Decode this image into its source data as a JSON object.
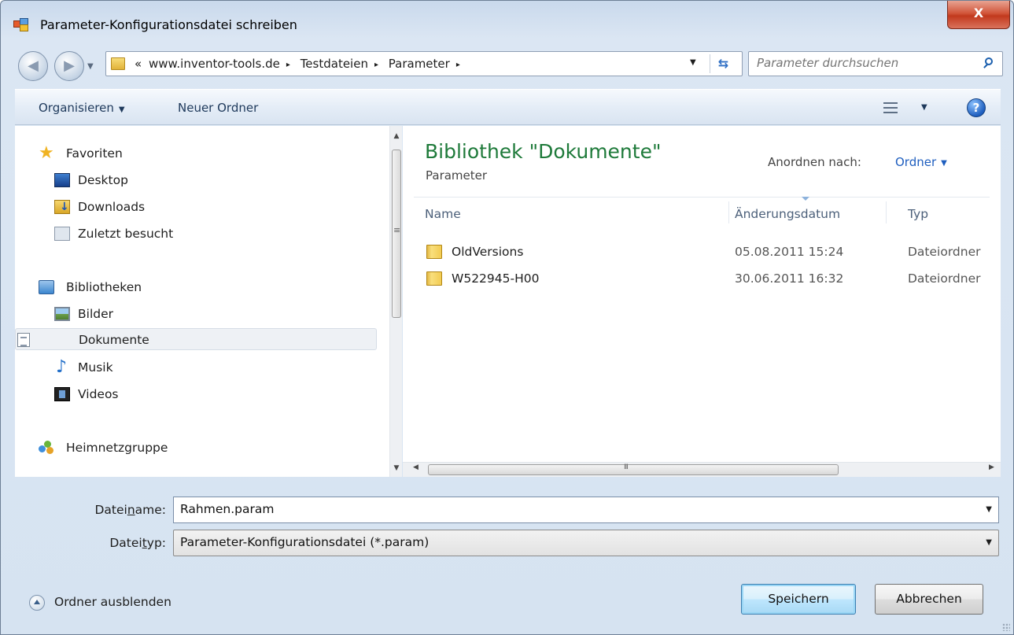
{
  "window": {
    "title": "Parameter-Konfigurationsdatei schreiben",
    "close_label": "X",
    "accent_color": "#1e7a3a",
    "link_color": "#1e5ebf"
  },
  "address_bar": {
    "chevron": "«",
    "crumbs": [
      "www.inventor-tools.de",
      "Testdateien",
      "Parameter"
    ],
    "separator": "▸",
    "dropdown_icon": "chevron-down-icon",
    "refresh_icon": "refresh-icon"
  },
  "search": {
    "placeholder": "Parameter durchsuchen"
  },
  "toolbar": {
    "organize_label": "Organisieren",
    "new_folder_label": "Neuer Ordner",
    "help_label": "?"
  },
  "nav": {
    "favorites": {
      "label": "Favoriten",
      "icon": "star-icon"
    },
    "favorite_items": [
      {
        "label": "Desktop",
        "icon": "desktop-icon"
      },
      {
        "label": "Downloads",
        "icon": "downloads-icon"
      },
      {
        "label": "Zuletzt besucht",
        "icon": "recent-places-icon"
      }
    ],
    "libraries": {
      "label": "Bibliotheken",
      "icon": "libraries-icon"
    },
    "library_items": [
      {
        "label": "Bilder",
        "icon": "pictures-icon"
      },
      {
        "label": "Dokumente",
        "icon": "documents-icon",
        "selected": true
      },
      {
        "label": "Musik",
        "icon": "music-icon"
      },
      {
        "label": "Videos",
        "icon": "videos-icon"
      }
    ],
    "homegroup": {
      "label": "Heimnetzgruppe",
      "icon": "homegroup-icon"
    }
  },
  "content": {
    "library_title": "Bibliothek \"Dokumente\"",
    "library_subtitle": "Parameter",
    "arrange_label": "Anordnen nach:",
    "arrange_value": "Ordner",
    "columns": {
      "name": "Name",
      "date": "Änderungsdatum",
      "type": "Typ"
    },
    "rows": [
      {
        "name": "OldVersions",
        "date": "05.08.2011 15:24",
        "type": "Dateiordner"
      },
      {
        "name": "W522945-H00",
        "date": "30.06.2011 16:32",
        "type": "Dateiordner"
      }
    ]
  },
  "form": {
    "filename_label_pre": "Datei",
    "filename_label_u": "n",
    "filename_label_post": "ame:",
    "filename_value": "Rahmen.param",
    "filetype_label_pre": "Datei",
    "filetype_label_u": "t",
    "filetype_label_post": "yp:",
    "filetype_value": "Parameter-Konfigurationsdatei (*.param)"
  },
  "footer": {
    "hide_folders_label": "Ordner ausblenden",
    "save_label": "Speichern",
    "cancel_label": "Abbrechen"
  }
}
